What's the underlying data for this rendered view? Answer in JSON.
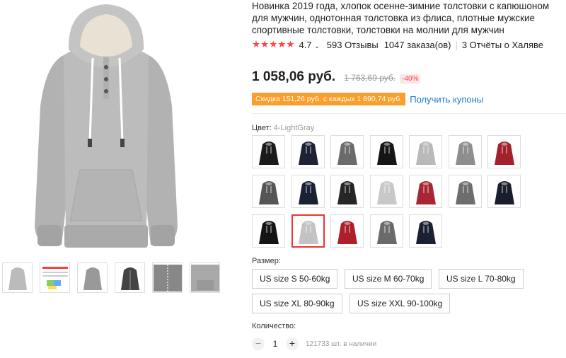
{
  "product": {
    "title": "Новинка 2019 года, хлопок осенне-зимние толстовки с капюшоном для мужчин, однотонная толстовка из флиса, плотные мужские спортивные толстовки, толстовки на молнии для мужчин",
    "stars": "★★★★★",
    "rating": "4.7",
    "reviews": "593 Отзывы",
    "orders": "1047 заказа(ов)",
    "reports": "3 Отчёты о Халяве"
  },
  "price": {
    "current": "1 058,06 руб.",
    "old": "1 763,69 руб.",
    "discount": "-40%"
  },
  "coupon": {
    "text": "Скидка 151,26 руб. с каждых 1 890,74 руб.",
    "link": "Получить купоны"
  },
  "color": {
    "label": "Цвет:",
    "selected": "4-LightGray",
    "swatches": [
      {
        "fill": "#1b1b1b"
      },
      {
        "fill": "#1e2237"
      },
      {
        "fill": "#6b6b6b"
      },
      {
        "fill": "#151515"
      },
      {
        "fill": "#b9b9b9"
      },
      {
        "fill": "#8e8e8e"
      },
      {
        "fill": "#a3212c"
      },
      {
        "fill": "#555555"
      },
      {
        "fill": "#1b2135"
      },
      {
        "fill": "#262626"
      },
      {
        "fill": "#c8c8c8"
      },
      {
        "fill": "#a82631"
      },
      {
        "fill": "#6d6d6d"
      },
      {
        "fill": "#1a1d2e"
      },
      {
        "fill": "#151515"
      },
      {
        "fill": "#c3c3c3",
        "selected": true
      },
      {
        "fill": "#ac1f2b"
      },
      {
        "fill": "#6a6a6a"
      },
      {
        "fill": "#1a1f33"
      }
    ]
  },
  "size": {
    "label": "Размер:",
    "options": [
      "US size S 50-60kg",
      "US size M 60-70kg",
      "US size L 70-80kg",
      "US size XL 80-90kg",
      "US size XXL 90-100kg"
    ]
  },
  "quantity": {
    "label": "Количество:",
    "minus": "−",
    "value": "1",
    "plus": "+",
    "stock": "121733 шт. в наличии"
  },
  "colors": {
    "accent": "#ff4747",
    "coupon": "#ff9d2a",
    "link": "#1a7ad3"
  }
}
